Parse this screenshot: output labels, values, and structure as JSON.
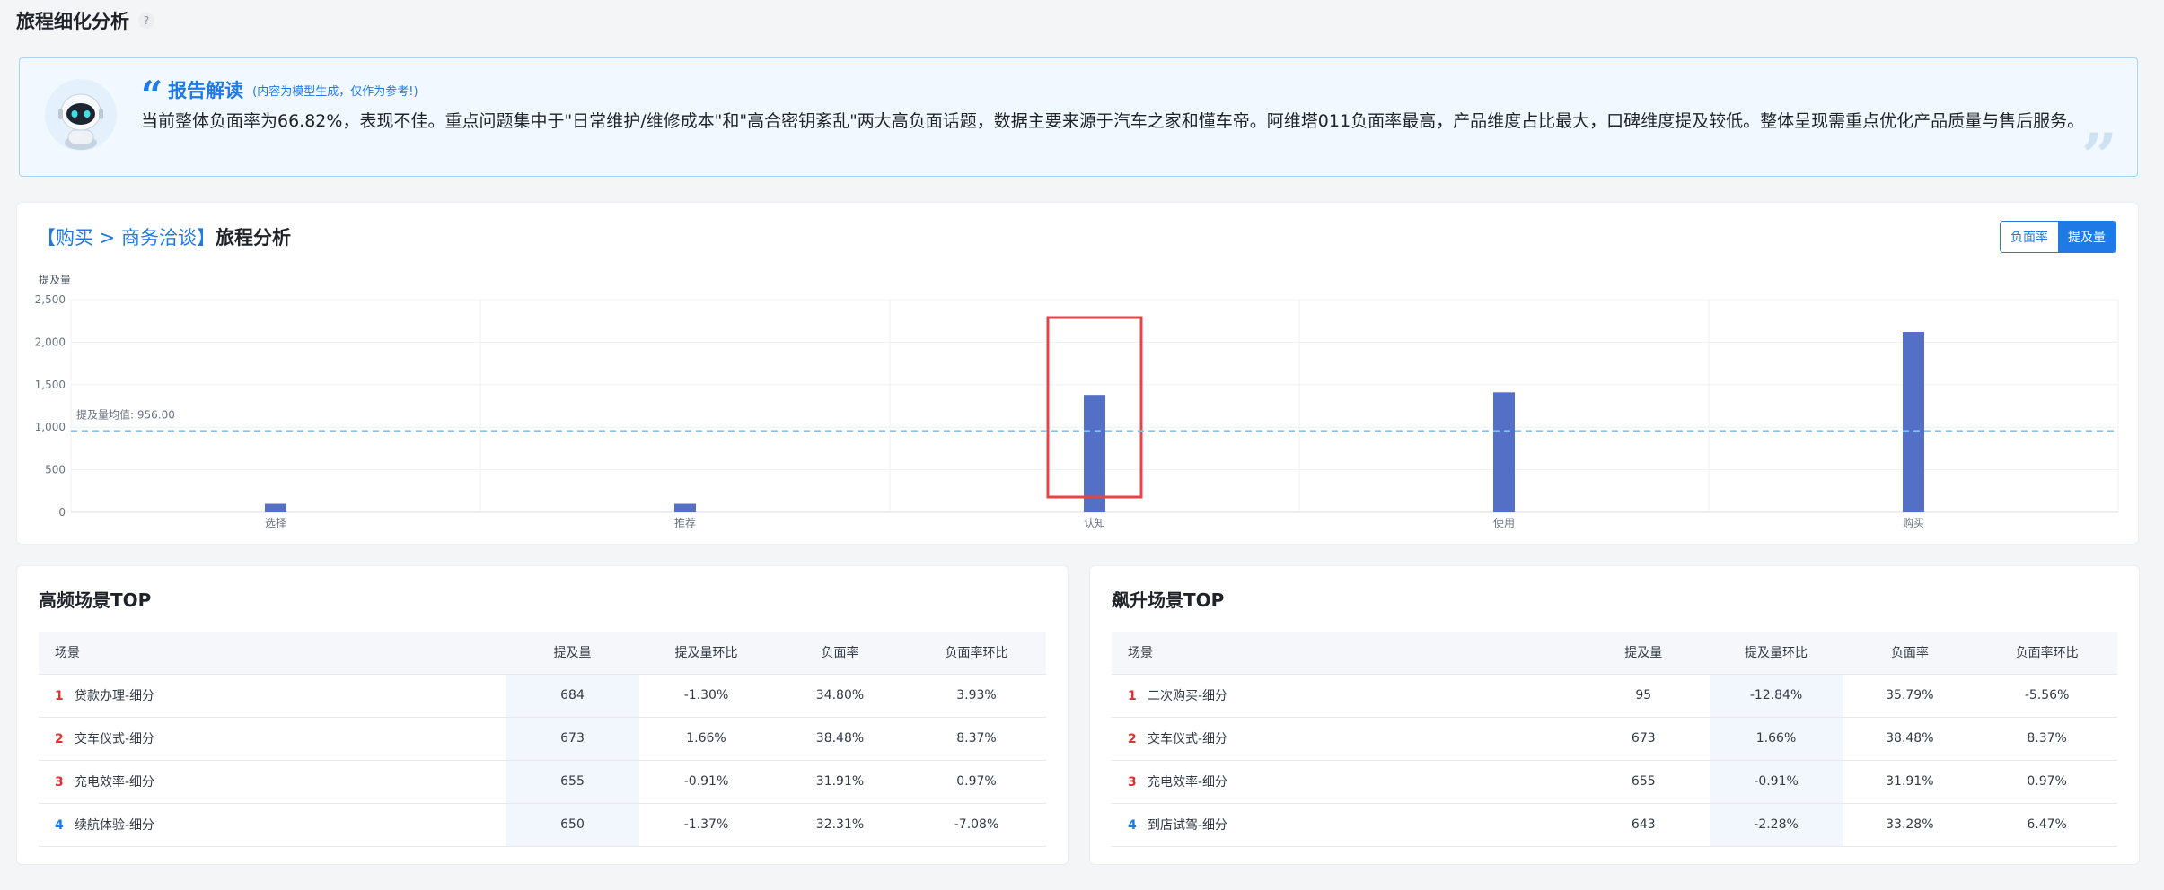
{
  "page": {
    "title": "旅程细化分析",
    "help_icon": "?"
  },
  "interpretation": {
    "title": "报告解读",
    "subtitle": "(内容为模型生成，仅作为参考!)",
    "text": "当前整体负面率为66.82%，表现不佳。重点问题集中于\"日常维护/维修成本\"和\"高合密钥紊乱\"两大高负面话题，数据主要来源于汽车之家和懂车帝。阿维塔011负面率最高，产品维度占比最大，口碑维度提及较低。整体呈现需重点优化产品质量与售后服务。"
  },
  "chart_card": {
    "crumb": "【购买 > 商务洽谈】",
    "name": "旅程分析",
    "toggle": [
      {
        "label": "负面率",
        "active": false
      },
      {
        "label": "提及量",
        "active": true
      }
    ]
  },
  "chart_data": {
    "type": "bar",
    "ylabel": "提及量",
    "ylim": [
      0,
      2500
    ],
    "yticks": [
      "0",
      "500",
      "1,000",
      "1,500",
      "2,000",
      "2,500"
    ],
    "categories": [
      "选择",
      "推荐",
      "认知",
      "使用",
      "购买"
    ],
    "values": [
      100,
      100,
      1380,
      1410,
      2120
    ],
    "avg_line": {
      "value": 956,
      "label": "提及量均值: 956.00"
    },
    "highlight_category": "认知",
    "bar_color": "#5470c6",
    "avg_color": "#7fc3f5",
    "highlight_color": "#e64545"
  },
  "tables": [
    {
      "title": "高频场景TOP",
      "headers": [
        "场景",
        "提及量",
        "提及量环比",
        "负面率",
        "负面率环比"
      ],
      "highlight_col": 1,
      "rows": [
        {
          "rank": "1",
          "scene": "贷款办理-细分",
          "mentions": "684",
          "mentions_mom": "-1.30%",
          "neg_rate": "34.80%",
          "neg_rate_mom": "3.93%"
        },
        {
          "rank": "2",
          "scene": "交车仪式-细分",
          "mentions": "673",
          "mentions_mom": "1.66%",
          "neg_rate": "38.48%",
          "neg_rate_mom": "8.37%"
        },
        {
          "rank": "3",
          "scene": "充电效率-细分",
          "mentions": "655",
          "mentions_mom": "-0.91%",
          "neg_rate": "31.91%",
          "neg_rate_mom": "0.97%"
        },
        {
          "rank": "4",
          "scene": "续航体验-细分",
          "mentions": "650",
          "mentions_mom": "-1.37%",
          "neg_rate": "32.31%",
          "neg_rate_mom": "-7.08%"
        }
      ]
    },
    {
      "title": "飙升场景TOP",
      "headers": [
        "场景",
        "提及量",
        "提及量环比",
        "负面率",
        "负面率环比"
      ],
      "highlight_col": 2,
      "rows": [
        {
          "rank": "1",
          "scene": "二次购买-细分",
          "mentions": "95",
          "mentions_mom": "-12.84%",
          "neg_rate": "35.79%",
          "neg_rate_mom": "-5.56%"
        },
        {
          "rank": "2",
          "scene": "交车仪式-细分",
          "mentions": "673",
          "mentions_mom": "1.66%",
          "neg_rate": "38.48%",
          "neg_rate_mom": "8.37%"
        },
        {
          "rank": "3",
          "scene": "充电效率-细分",
          "mentions": "655",
          "mentions_mom": "-0.91%",
          "neg_rate": "31.91%",
          "neg_rate_mom": "0.97%"
        },
        {
          "rank": "4",
          "scene": "到店试驾-细分",
          "mentions": "643",
          "mentions_mom": "-2.28%",
          "neg_rate": "33.28%",
          "neg_rate_mom": "6.47%"
        }
      ]
    }
  ]
}
